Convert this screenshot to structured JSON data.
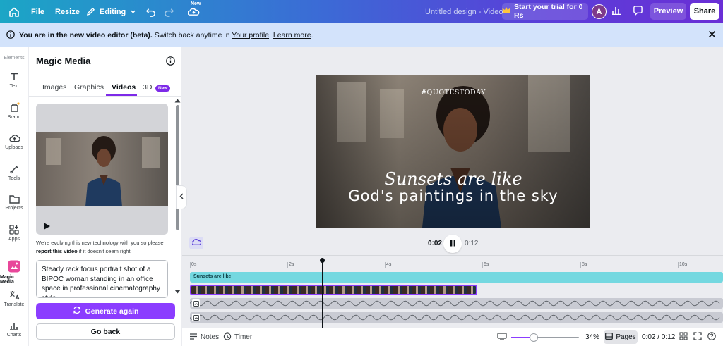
{
  "topbar": {
    "file_label": "File",
    "resize_label": "Resize",
    "editing_label": "Editing",
    "new_badge": "New",
    "doc_title": "Untitled design - Video",
    "trial_label": "Start your trial for 0 Rs",
    "avatar_initial": "A",
    "preview_label": "Preview",
    "share_label": "Share"
  },
  "banner": {
    "bold_text": "You are in the new video editor (beta).",
    "text_1": " Switch back anytime in ",
    "link_profile": "Your profile",
    "text_2": ". ",
    "link_learn": "Learn more",
    "text_3": "."
  },
  "rail": {
    "elements": "Elements",
    "text": "Text",
    "brand": "Brand",
    "uploads": "Uploads",
    "tools": "Tools",
    "projects": "Projects",
    "apps": "Apps",
    "magic_media": "Magic Media",
    "translate": "Translate",
    "charts": "Charts"
  },
  "panel": {
    "title": "Magic Media",
    "tabs": [
      "Images",
      "Graphics",
      "Videos",
      "3D"
    ],
    "active_tab": "Videos",
    "tab_3d_badge": "New",
    "disclaimer_1": "We're evolving this new technology with you so please ",
    "disclaimer_link": "report this video",
    "disclaimer_2": " if it doesn't seem right.",
    "prompt": "Steady rack focus portrait shot of a BIPOC woman standing in an office space in professional cinematography style",
    "generate_label": "Generate again",
    "go_back_label": "Go back"
  },
  "canvas": {
    "hashtag": "#QUOTESTODAY",
    "script_line": "Sunsets are like",
    "caption": "God's paintings in the sky"
  },
  "playback": {
    "current": "0:02",
    "total": "0:12"
  },
  "timeline": {
    "ticks": [
      "0s",
      "2s",
      "4s",
      "6s",
      "8s",
      "10s"
    ],
    "text_track_label": "Sunsets are like"
  },
  "bottombar": {
    "notes_label": "Notes",
    "timer_label": "Timer",
    "zoom": "34%",
    "pages_label": "Pages",
    "time_readout": "0:02 / 0:12"
  },
  "colors": {
    "accent": "#8b3dff",
    "text_track": "#74d8e0",
    "banner": "#d3e3fb"
  }
}
